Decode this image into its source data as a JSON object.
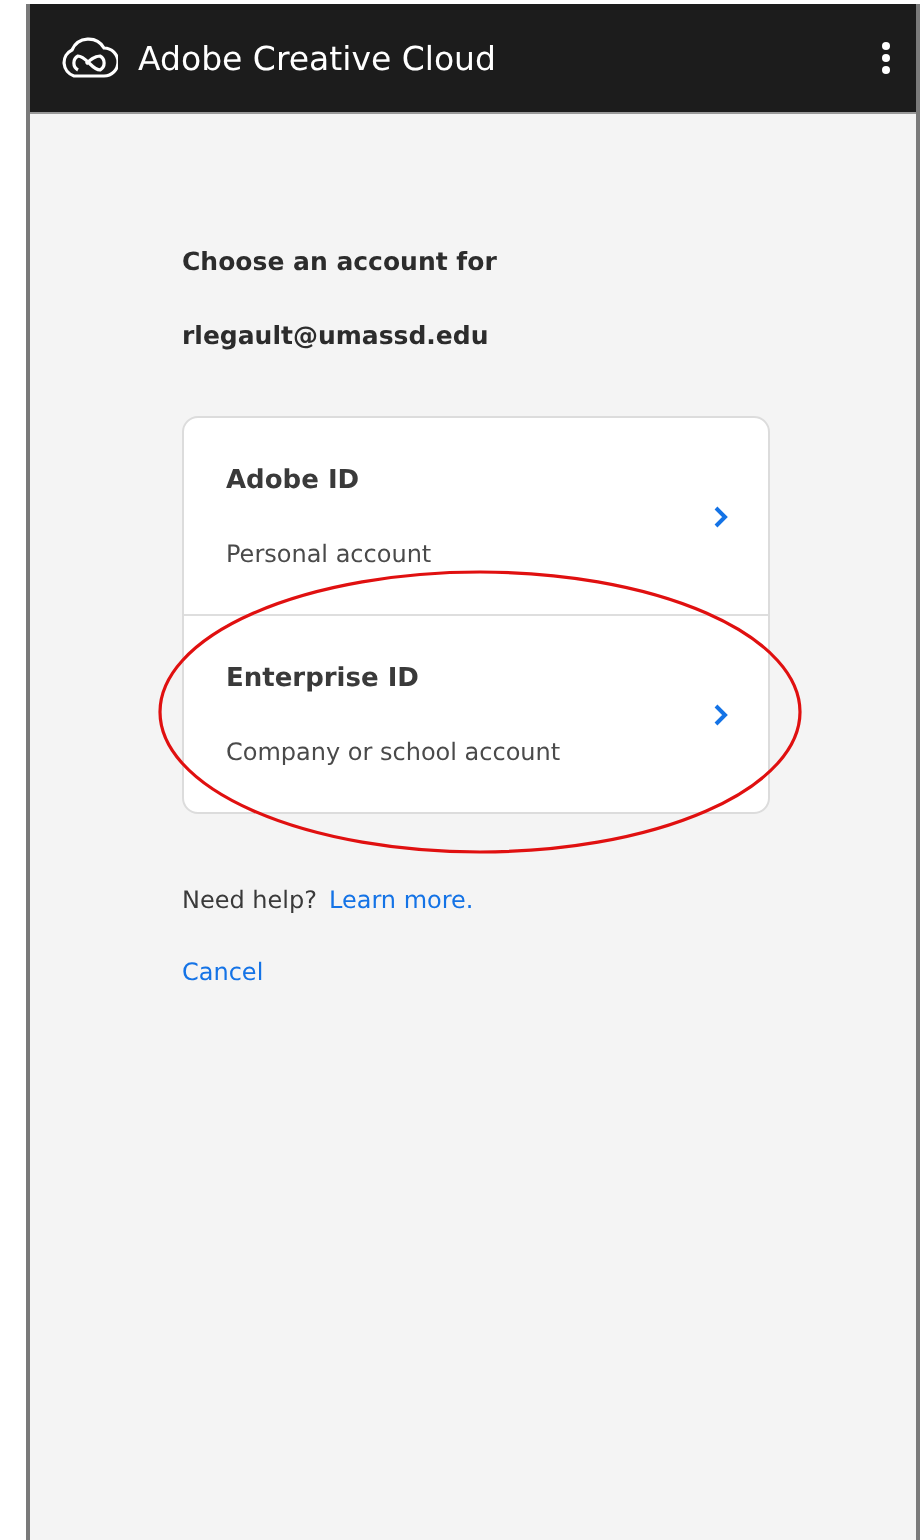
{
  "window": {
    "title": "Adobe Creative Cloud"
  },
  "heading": "Choose an account for",
  "email": "rlegault@umassd.edu",
  "accounts": [
    {
      "title": "Adobe ID",
      "subtitle": "Personal account",
      "highlighted": false
    },
    {
      "title": "Enterprise ID",
      "subtitle": "Company or school account",
      "highlighted": true
    }
  ],
  "help": {
    "text": "Need help?",
    "link": "Learn more."
  },
  "cancel": "Cancel"
}
